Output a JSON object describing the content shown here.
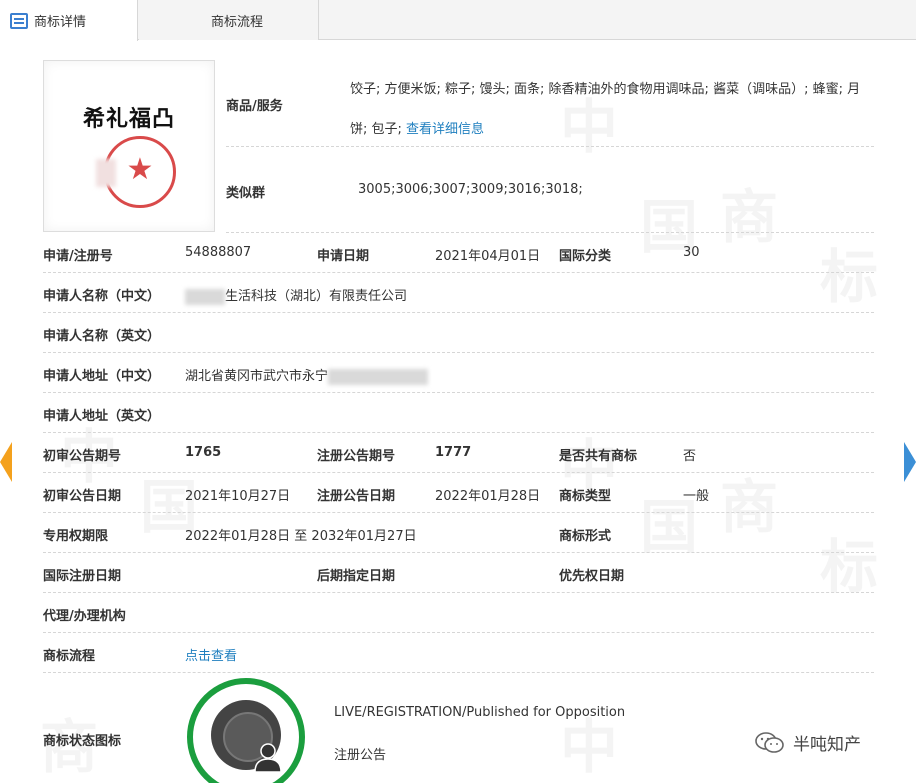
{
  "tabs": [
    {
      "label": "商标详情",
      "active": true
    },
    {
      "label": "商标流程",
      "active": false
    }
  ],
  "mark": {
    "image_text": "希礼福凸"
  },
  "goods_services": {
    "label": "商品/服务",
    "value": "饺子; 方便米饭; 粽子; 馒头; 面条; 除香精油外的食物用调味品; 酱菜（调味品）; 蜂蜜; 月饼; 包子; ",
    "link": "查看详细信息"
  },
  "similar_group": {
    "label": "类似群",
    "value": "3005;3006;3007;3009;3016;3018;"
  },
  "fields": {
    "reg_no_label": "申请/注册号",
    "reg_no": "54888807",
    "app_date_label": "申请日期",
    "app_date": "2021年04月01日",
    "intl_class_label": "国际分类",
    "intl_class": "30",
    "applicant_cn_label": "申请人名称（中文）",
    "applicant_cn": "生活科技（湖北）有限责任公司",
    "applicant_en_label": "申请人名称（英文）",
    "address_cn_label": "申请人地址（中文）",
    "address_cn": "湖北省黄冈市武穴市永宁",
    "address_en_label": "申请人地址（英文）",
    "prelim_no_label": "初审公告期号",
    "prelim_no": "1765",
    "reg_pub_no_label": "注册公告期号",
    "reg_pub_no": "1777",
    "shared_label": "是否共有商标",
    "shared": "否",
    "prelim_date_label": "初审公告日期",
    "prelim_date": "2021年10月27日",
    "reg_pub_date_label": "注册公告日期",
    "reg_pub_date": "2022年01月28日",
    "mark_type_label": "商标类型",
    "mark_type": "一般",
    "exclusive_label": "专用权期限",
    "exclusive": "2022年01月28日 至 2032年01月27日",
    "mark_form_label": "商标形式",
    "intl_reg_date_label": "国际注册日期",
    "later_date_label": "后期指定日期",
    "priority_label": "优先权日期",
    "agent_label": "代理/办理机构",
    "flow_label": "商标流程",
    "flow_link": "点击查看",
    "status_icon_label": "商标状态图标"
  },
  "status": {
    "text_en": "LIVE/REGISTRATION/Published for Opposition",
    "text_cn": "注册公告",
    "color": "#1b9e3e"
  },
  "watermark": {
    "chars": [
      "中",
      "国",
      "商",
      "标"
    ]
  },
  "footer": {
    "wechat_name": "半吨知产"
  }
}
